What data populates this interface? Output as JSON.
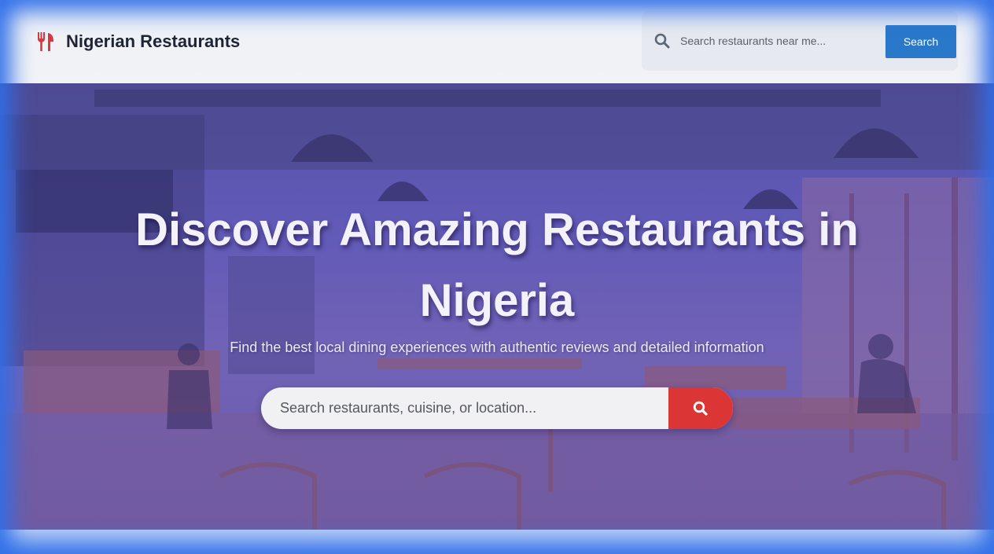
{
  "header": {
    "brand_icon": "utensils-icon",
    "brand_name": "Nigerian Restaurants",
    "search": {
      "icon": "search-icon",
      "placeholder": "Search restaurants near me...",
      "button_label": "Search"
    }
  },
  "hero": {
    "title": "Discover Amazing Restaurants in Nigeria",
    "subtitle": "Find the best local dining experiences with authentic reviews and detailed information",
    "search": {
      "placeholder": "Search restaurants, cuisine, or location...",
      "button_icon": "search-icon"
    }
  },
  "colors": {
    "accent_blue": "#2a78c9",
    "accent_red": "#dc3535",
    "brand_icon": "#d9363e",
    "frame": "#2f6fe8"
  }
}
